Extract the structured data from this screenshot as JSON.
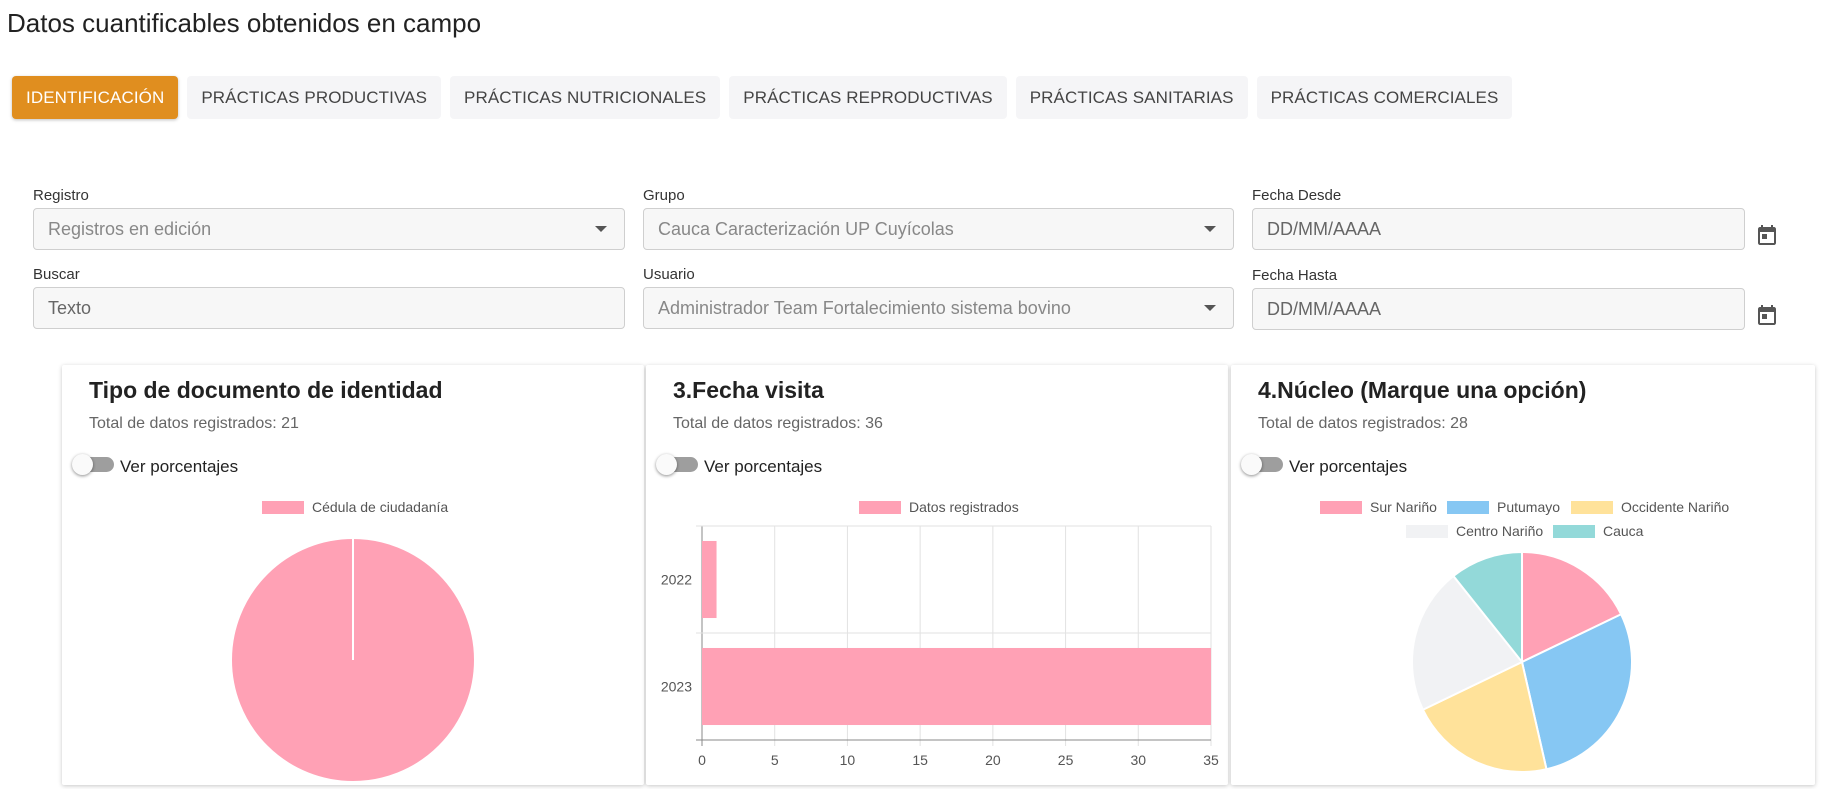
{
  "page": {
    "title": "Datos cuantificables obtenidos en campo"
  },
  "tabs": [
    {
      "label": "IDENTIFICACIÓN",
      "active": true
    },
    {
      "label": "PRÁCTICAS PRODUCTIVAS",
      "active": false
    },
    {
      "label": "PRÁCTICAS NUTRICIONALES",
      "active": false
    },
    {
      "label": "PRÁCTICAS REPRODUCTIVAS",
      "active": false
    },
    {
      "label": "PRÁCTICAS SANITARIAS",
      "active": false
    },
    {
      "label": "PRÁCTICAS COMERCIALES",
      "active": false
    }
  ],
  "filters": {
    "registro": {
      "label": "Registro",
      "value": "Registros en edición"
    },
    "grupo": {
      "label": "Grupo",
      "value": "Cauca Caracterización UP Cuyícolas"
    },
    "fecha_desde": {
      "label": "Fecha Desde",
      "placeholder": "DD/MM/AAAA"
    },
    "buscar": {
      "label": "Buscar",
      "placeholder": "Texto"
    },
    "usuario": {
      "label": "Usuario",
      "value": "Administrador Team Fortalecimiento sistema bovino"
    },
    "fecha_hasta": {
      "label": "Fecha Hasta",
      "placeholder": "DD/MM/AAAA"
    },
    "calendar_icon": "calendar-icon"
  },
  "cards": [
    {
      "title": "Tipo de documento de identidad",
      "subtitle": "Total de datos registrados: 21",
      "toggle_label": "Ver porcentajes"
    },
    {
      "title": "3.Fecha visita",
      "subtitle": "Total de datos registrados: 36",
      "toggle_label": "Ver porcentajes"
    },
    {
      "title": "4.Núcleo (Marque una opción)",
      "subtitle": "Total de datos registrados: 28",
      "toggle_label": "Ver porcentajes"
    }
  ],
  "colors": {
    "accent": "#e08e1f",
    "pink": "#ffa1b5",
    "blue": "#86c7f3",
    "yellow": "#ffe29a",
    "gray": "#f1f2f4",
    "teal": "#93d9d9"
  },
  "chart_data": [
    {
      "type": "pie",
      "title": "Tipo de documento de identidad",
      "legend": "top",
      "labels": [
        "Cédula de ciudadanía"
      ],
      "values": [
        21
      ]
    },
    {
      "type": "bar",
      "orientation": "horizontal",
      "title": "3.Fecha visita",
      "legend": "top",
      "categories": [
        "2022",
        "2023"
      ],
      "series": [
        {
          "name": "Datos registrados",
          "values": [
            1,
            35
          ]
        }
      ],
      "xlim": [
        0,
        35
      ],
      "ticks": [
        "0",
        "5",
        "10",
        "15",
        "20",
        "25",
        "30",
        "35"
      ],
      "grid": true
    },
    {
      "type": "pie",
      "title": "4.Núcleo (Marque una opción)",
      "legend": "top",
      "labels": [
        "Sur Nariño",
        "Putumayo",
        "Occidente Nariño",
        "Centro Nariño",
        "Cauca"
      ],
      "values": [
        5,
        8,
        6,
        6,
        3
      ]
    }
  ]
}
